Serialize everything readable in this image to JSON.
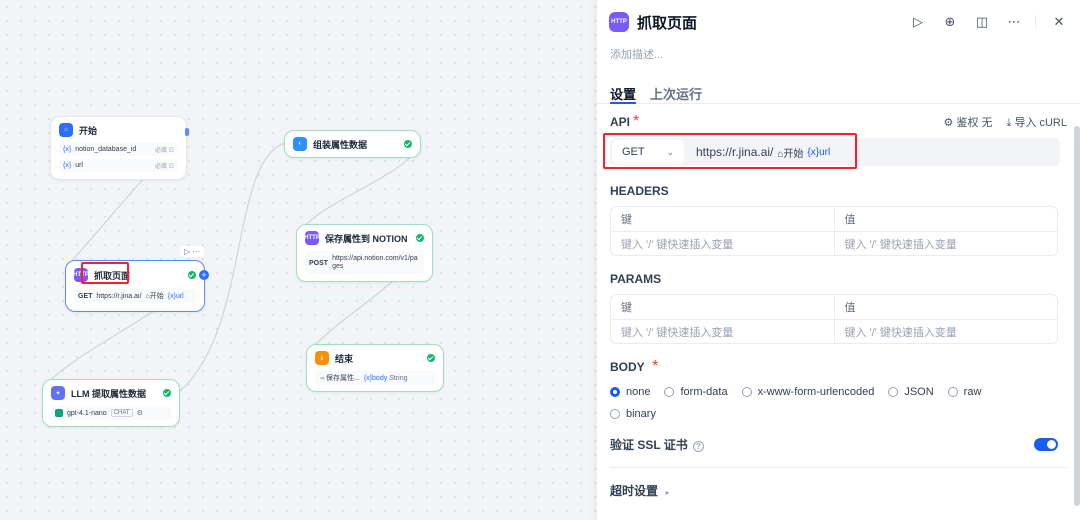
{
  "canvas": {
    "start_node": {
      "title": "开始",
      "vars": [
        {
          "name": "notion_database_id",
          "tag": "必填 ☷"
        },
        {
          "name": "url",
          "tag": "必填 ☷"
        }
      ]
    },
    "fetch_node": {
      "title": "抓取页面",
      "method": "GET",
      "url": "https://r.jina.ai/",
      "chip_start": "⌂开始",
      "chip_var": "{x}url",
      "toolbar": "▷ ···"
    },
    "llm_node": {
      "title": "LLM 提取属性数据",
      "model": "gpt-4.1-nano",
      "badge": "CHAT"
    },
    "assemble_node": {
      "title": "组装属性数据"
    },
    "save_node": {
      "title": "保存属性到 NOTION",
      "method": "POST",
      "url": "https://api.notion.com/v1/pages"
    },
    "end_node": {
      "title": "结束",
      "var_prefix": "⇔保存属性...",
      "var_x": "{x}",
      "var_name": "body",
      "var_type": "String"
    }
  },
  "panel": {
    "title": "抓取页面",
    "icon": "HTTP",
    "description_placeholder": "添加描述...",
    "tabs": [
      "设置",
      "上次运行"
    ],
    "api_label": "API",
    "required_mark": "*",
    "auth_label": "鉴权 无",
    "import_label": "导入 cURL",
    "method": "GET",
    "url_prefix": "https://r.jina.ai/",
    "url_chip_start": "⌂开始",
    "url_chip_var": "{x}url",
    "headers_label": "HEADERS",
    "params_label": "PARAMS",
    "key_col": "键",
    "value_col": "值",
    "kv_placeholder": "键入 '/' 键快速插入变量",
    "body_label": "BODY",
    "body_options": [
      "none",
      "form-data",
      "x-www-form-urlencoded",
      "JSON",
      "raw",
      "binary"
    ],
    "body_selected": "none",
    "ssl_label": "验证 SSL 证书",
    "ssl_enabled": true,
    "timeout_label": "超时设置",
    "colors": {
      "accent": "#155eef",
      "http_icon": "#7a5af8",
      "success": "#12b76a",
      "highlight": "#f5222d"
    }
  }
}
